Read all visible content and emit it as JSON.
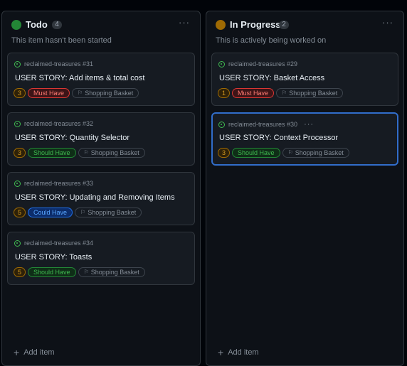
{
  "columns": [
    {
      "title": "Todo",
      "count": "4",
      "description": "This item hasn't been started",
      "status_color": "#238636",
      "menu_icon": "···",
      "add_label": "Add item",
      "cards": [
        {
          "repo": "reclaimed-treasures",
          "number": "#31",
          "title": "USER STORY: Add items & total cost",
          "estimate": "3",
          "priority": "Must Have",
          "priority_type": "must",
          "field_label": "Shopping Basket"
        },
        {
          "repo": "reclaimed-treasures",
          "number": "#32",
          "title": "USER STORY: Quantity Selector",
          "estimate": "3",
          "priority": "Should Have",
          "priority_type": "should",
          "field_label": "Shopping Basket"
        },
        {
          "repo": "reclaimed-treasures",
          "number": "#33",
          "title": "USER STORY: Updating and Removing Items",
          "estimate": "5",
          "priority": "Could Have",
          "priority_type": "could",
          "field_label": "Shopping Basket"
        },
        {
          "repo": "reclaimed-treasures",
          "number": "#34",
          "title": "USER STORY: Toasts",
          "estimate": "5",
          "priority": "Should Have",
          "priority_type": "should",
          "field_label": "Shopping Basket"
        }
      ]
    },
    {
      "title": "In Progress",
      "count": "2",
      "description": "This is actively being worked on",
      "status_color": "#9e6a03",
      "menu_icon": "···",
      "add_label": "Add item",
      "cards": [
        {
          "repo": "reclaimed-treasures",
          "number": "#29",
          "title": "USER STORY: Basket Access",
          "estimate": "1",
          "priority": "Must Have",
          "priority_type": "must",
          "field_label": "Shopping Basket"
        },
        {
          "repo": "reclaimed-treasures",
          "number": "#30",
          "title": "USER STORY: Context Processor",
          "estimate": "3",
          "priority": "Should Have",
          "priority_type": "should",
          "field_label": "Shopping Basket",
          "selected": true,
          "card_menu": "···"
        }
      ]
    }
  ],
  "colors": {
    "must": {
      "text": "#ff7b72",
      "border": "#da3633",
      "bg": "#3d1417"
    },
    "should": {
      "text": "#3fb950",
      "border": "#238636",
      "bg": "#0f2e17"
    },
    "could": {
      "text": "#58a6ff",
      "border": "#1f6feb",
      "bg": "#0c2d6b"
    },
    "estimate": {
      "text": "#d29922",
      "border": "#9e6a03",
      "bg": "#2e2108"
    }
  }
}
